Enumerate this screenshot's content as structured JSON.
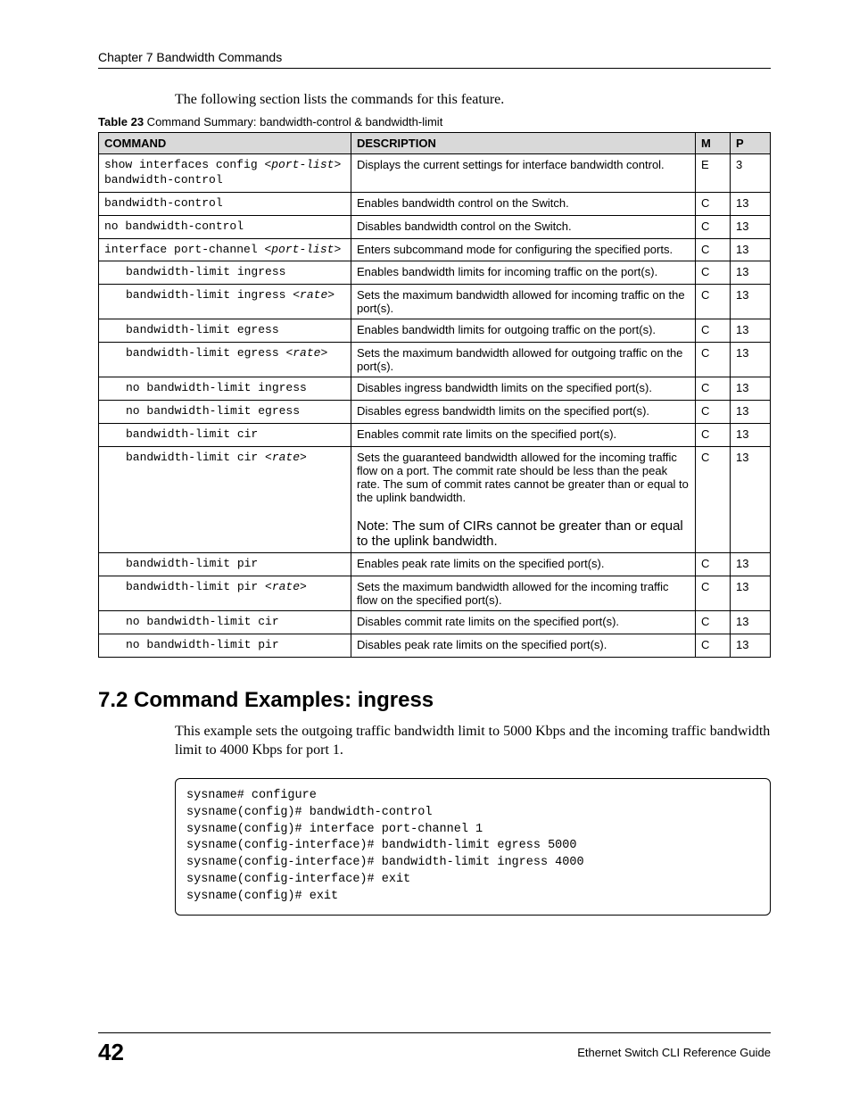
{
  "header": {
    "chapter": "Chapter 7 Bandwidth Commands"
  },
  "intro": "The following section lists the commands for this feature.",
  "table": {
    "caption_bold": "Table 23",
    "caption_rest": "   Command Summary: bandwidth-control & bandwidth-limit",
    "head": {
      "command": "COMMAND",
      "description": "DESCRIPTION",
      "m": "M",
      "p": "P"
    },
    "rows": [
      {
        "cmd_pre": "show interfaces config ",
        "cmd_arg": "<port-list>",
        "cmd_post": " bandwidth-control",
        "indent": false,
        "desc": "Displays the current settings for interface bandwidth control.",
        "m": "E",
        "p": "3"
      },
      {
        "cmd_pre": "bandwidth-control",
        "cmd_arg": "",
        "cmd_post": "",
        "indent": false,
        "desc": "Enables bandwidth control on the Switch.",
        "m": "C",
        "p": "13"
      },
      {
        "cmd_pre": "no bandwidth-control",
        "cmd_arg": "",
        "cmd_post": "",
        "indent": false,
        "desc": "Disables bandwidth control on the Switch.",
        "m": "C",
        "p": "13"
      },
      {
        "cmd_pre": "interface port-channel ",
        "cmd_arg": "<port-list>",
        "cmd_post": "",
        "indent": false,
        "desc": "Enters subcommand mode for configuring the specified ports.",
        "m": "C",
        "p": "13"
      },
      {
        "cmd_pre": "bandwidth-limit ingress",
        "cmd_arg": "",
        "cmd_post": "",
        "indent": true,
        "desc": "Enables bandwidth limits for incoming traffic on the port(s).",
        "m": "C",
        "p": "13"
      },
      {
        "cmd_pre": "bandwidth-limit ingress ",
        "cmd_arg": "<rate>",
        "cmd_post": "",
        "indent": true,
        "desc": "Sets the maximum bandwidth allowed for incoming traffic on the port(s).",
        "m": "C",
        "p": "13"
      },
      {
        "cmd_pre": "bandwidth-limit egress",
        "cmd_arg": "",
        "cmd_post": "",
        "indent": true,
        "desc": "Enables bandwidth limits for outgoing traffic on the port(s).",
        "m": "C",
        "p": "13"
      },
      {
        "cmd_pre": "bandwidth-limit egress ",
        "cmd_arg": "<rate>",
        "cmd_post": "",
        "indent": true,
        "desc": "Sets the maximum bandwidth allowed for outgoing traffic on the port(s).",
        "m": "C",
        "p": "13"
      },
      {
        "cmd_pre": "no bandwidth-limit ingress",
        "cmd_arg": "",
        "cmd_post": "",
        "indent": true,
        "desc": "Disables ingress bandwidth limits on the specified port(s).",
        "m": "C",
        "p": "13"
      },
      {
        "cmd_pre": "no bandwidth-limit egress",
        "cmd_arg": "",
        "cmd_post": "",
        "indent": true,
        "desc": "Disables egress bandwidth limits on the specified port(s).",
        "m": "C",
        "p": "13"
      },
      {
        "cmd_pre": "bandwidth-limit cir",
        "cmd_arg": "",
        "cmd_post": "",
        "indent": true,
        "desc": "Enables commit rate limits on the specified port(s).",
        "m": "C",
        "p": "13"
      },
      {
        "cmd_pre": "bandwidth-limit cir ",
        "cmd_arg": "<rate>",
        "cmd_post": "",
        "indent": true,
        "desc": "Sets the guaranteed bandwidth allowed for the incoming traffic flow on a port. The commit rate should be less than the peak rate. The sum of commit rates cannot be greater than or equal to the uplink bandwidth.",
        "note": "Note: The sum of CIRs cannot be greater than or equal to the uplink bandwidth.",
        "m": "C",
        "p": "13"
      },
      {
        "cmd_pre": "bandwidth-limit pir",
        "cmd_arg": "",
        "cmd_post": "",
        "indent": true,
        "desc": "Enables peak rate limits on the specified port(s).",
        "m": "C",
        "p": "13"
      },
      {
        "cmd_pre": "bandwidth-limit pir ",
        "cmd_arg": "<rate>",
        "cmd_post": "",
        "indent": true,
        "desc": "Sets the maximum bandwidth allowed for the incoming traffic flow on the specified port(s).",
        "m": "C",
        "p": "13"
      },
      {
        "cmd_pre": "no bandwidth-limit cir",
        "cmd_arg": "",
        "cmd_post": "",
        "indent": true,
        "desc": "Disables commit rate limits on the specified port(s).",
        "m": "C",
        "p": "13"
      },
      {
        "cmd_pre": "no bandwidth-limit pir",
        "cmd_arg": "",
        "cmd_post": "",
        "indent": true,
        "desc": "Disables peak rate limits on the specified port(s).",
        "m": "C",
        "p": "13"
      }
    ]
  },
  "section": {
    "heading": "7.2  Command Examples: ingress",
    "body": "This example sets the outgoing traffic bandwidth limit to 5000 Kbps and the incoming traffic bandwidth limit to 4000 Kbps for port 1.",
    "code": "sysname# configure\nsysname(config)# bandwidth-control\nsysname(config)# interface port-channel 1\nsysname(config-interface)# bandwidth-limit egress 5000\nsysname(config-interface)# bandwidth-limit ingress 4000\nsysname(config-interface)# exit\nsysname(config)# exit"
  },
  "footer": {
    "page": "42",
    "title": "Ethernet Switch CLI Reference Guide"
  }
}
